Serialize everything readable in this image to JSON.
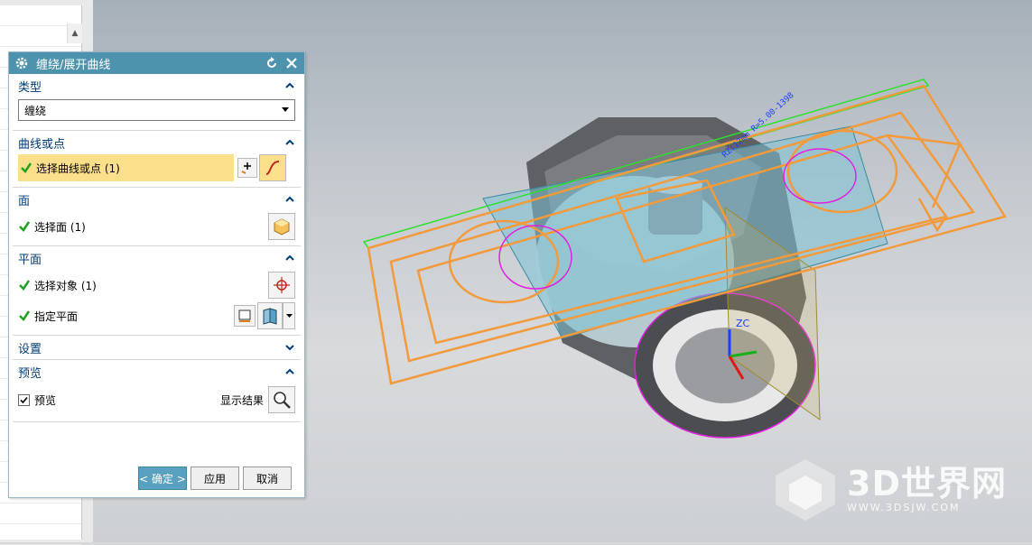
{
  "dialog": {
    "title": "缠绕/展开曲线",
    "sections": {
      "type": {
        "label": "类型",
        "value": "缠绕"
      },
      "curve": {
        "label": "曲线或点",
        "select_label": "选择曲线或点 (1)"
      },
      "face": {
        "label": "面",
        "select_label": "选择面 (1)"
      },
      "plane": {
        "label": "平面",
        "select_object": "选择对象 (1)",
        "specify_plane": "指定平面"
      },
      "settings": {
        "label": "设置"
      },
      "preview": {
        "label": "预览",
        "checkbox_label": "预览",
        "show_result": "显示结果"
      }
    },
    "buttons": {
      "ok": "< 确定 >",
      "apply": "应用",
      "cancel": "取消"
    }
  },
  "viewport": {
    "text_annotation": "RZ:12mm  R=5.00-1398",
    "axis_label": "ZC"
  },
  "watermark": {
    "brand": "3D世界网",
    "url": "WWW.3DSJW.COM"
  },
  "colors": {
    "accent": "#4d93ad",
    "selection_highlight": "#fbdf8b",
    "curve_orange": "#f29a3c",
    "face_magenta": "#e020e0"
  }
}
